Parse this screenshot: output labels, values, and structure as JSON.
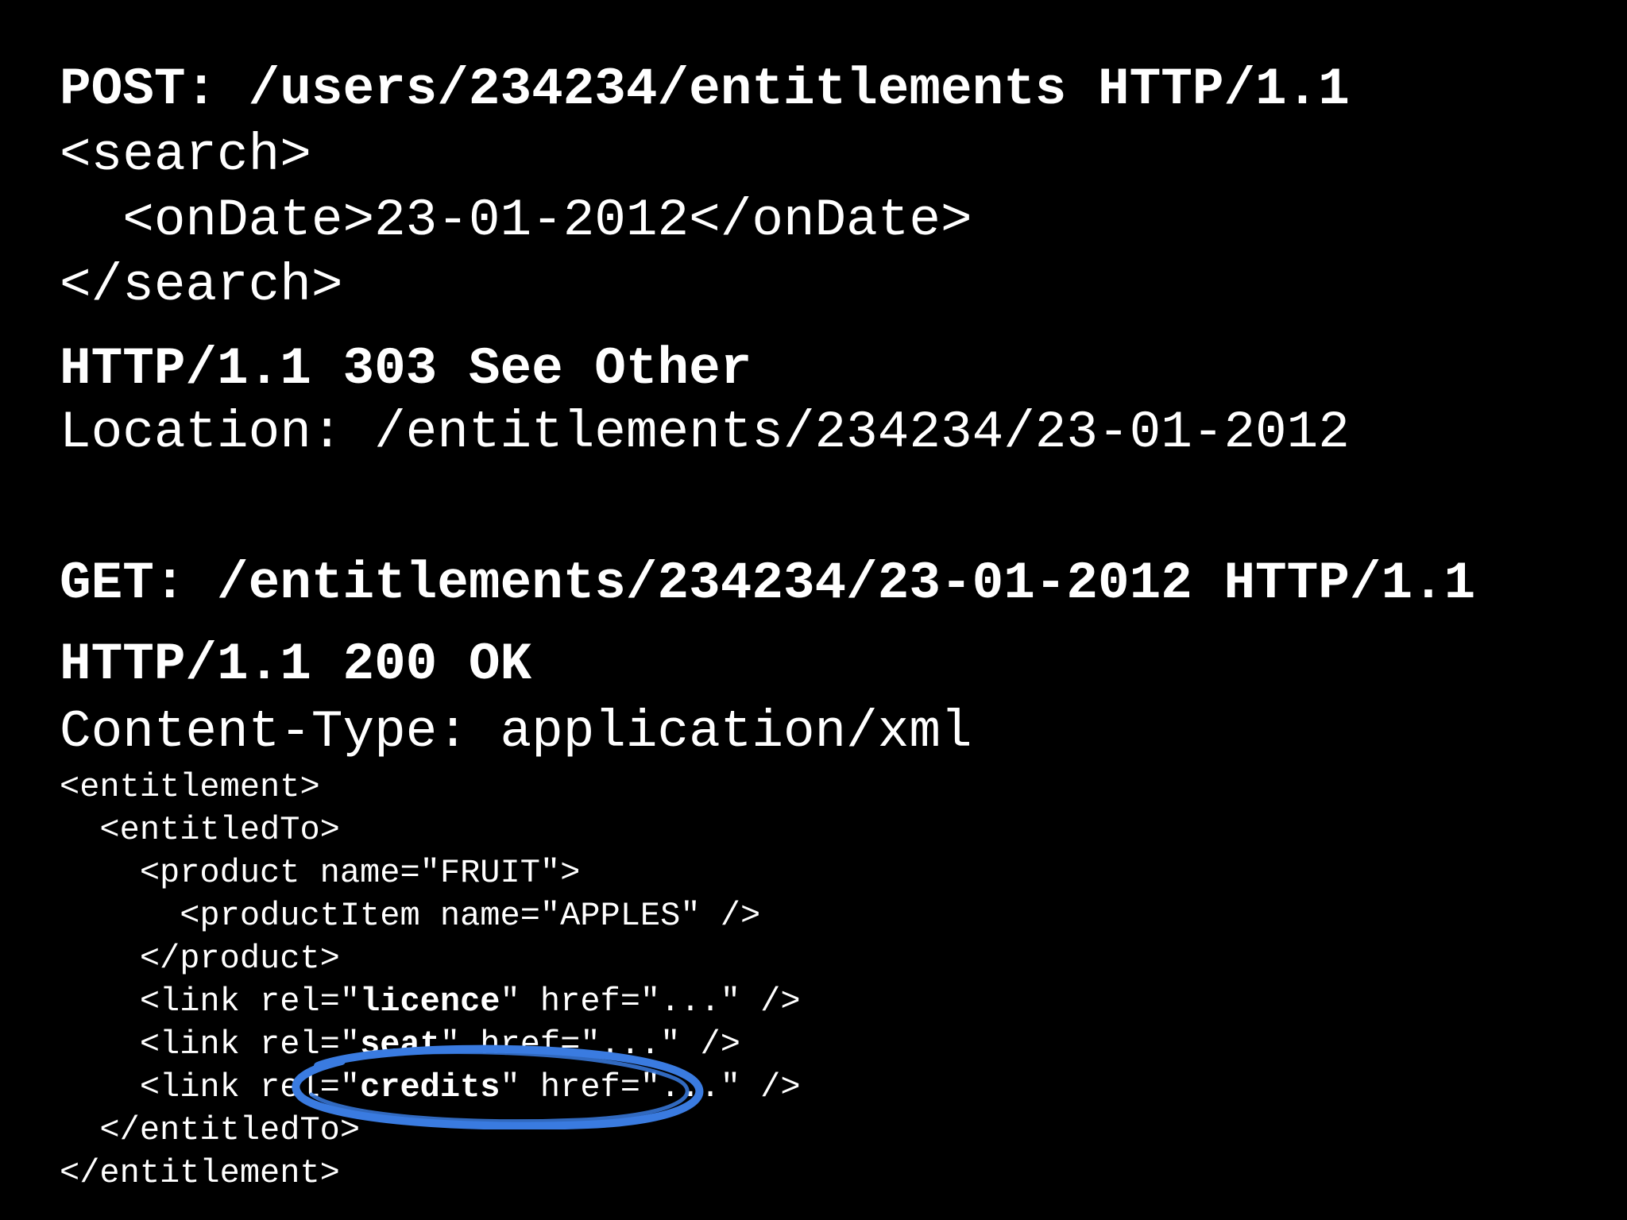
{
  "request1": {
    "method_line": "POST: /users/234234/entitlements HTTP/1.1",
    "body_lines": [
      "<search>",
      "  <onDate>23-01-2012</onDate>",
      "</search>"
    ]
  },
  "response1": {
    "status_line": "HTTP/1.1 303 See Other",
    "location_line": "Location: /entitlements/234234/23-01-2012"
  },
  "request2": {
    "method_line": "GET: /entitlements/234234/23-01-2012 HTTP/1.1"
  },
  "response2": {
    "status_line": "HTTP/1.1 200 OK",
    "content_type_line": "Content-Type: application/xml",
    "xml": {
      "l1": "<entitlement>",
      "l2": "  <entitledTo>",
      "l3": "    <product name=\"FRUIT\">",
      "l4": "      <productItem name=\"APPLES\" />",
      "l5": "    </product>",
      "link_prefix": "    <link rel=\"",
      "link_suffix": "\" href=\"...\" />",
      "rel_licence": "licence",
      "rel_seat": "seat",
      "rel_credits": "credits",
      "l9": "  </entitledTo>",
      "l10": "</entitlement>"
    }
  },
  "highlight": {
    "color": "#3a7be0"
  }
}
